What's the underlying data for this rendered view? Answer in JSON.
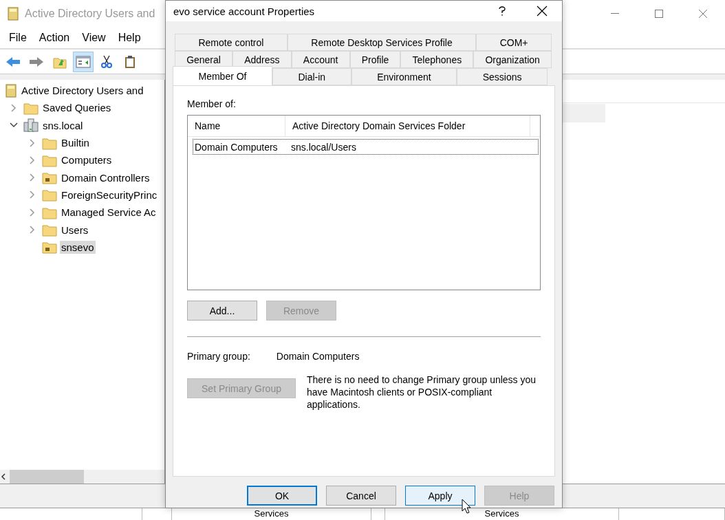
{
  "main_window": {
    "title": "Active Directory Users and",
    "menu": [
      "File",
      "Action",
      "View",
      "Help"
    ],
    "toolbar": [
      {
        "kind": "back",
        "selected": false
      },
      {
        "kind": "forward",
        "selected": false
      },
      {
        "kind": "up",
        "selected": false
      },
      {
        "kind": "tree",
        "selected": true
      },
      {
        "kind": "cut",
        "selected": false
      },
      {
        "kind": "paste",
        "selected": false
      }
    ],
    "tree": [
      {
        "label": "Active Directory Users and",
        "kind": "root",
        "selected": false,
        "children": [
          {
            "label": "Saved Queries",
            "kind": "folder",
            "expanded": false,
            "selected": false
          },
          {
            "label": "sns.local",
            "kind": "domain",
            "expanded": true,
            "selected": false,
            "children": [
              {
                "label": "Builtin",
                "kind": "folder",
                "expanded": false,
                "selected": false
              },
              {
                "label": "Computers",
                "kind": "folder",
                "expanded": false,
                "selected": false
              },
              {
                "label": "Domain Controllers",
                "kind": "ou",
                "expanded": false,
                "selected": false
              },
              {
                "label": "ForeignSecurityPrinc",
                "kind": "folder",
                "expanded": false,
                "selected": false
              },
              {
                "label": "Managed Service Ac",
                "kind": "folder",
                "expanded": false,
                "selected": false
              },
              {
                "label": "Users",
                "kind": "folder",
                "expanded": false,
                "selected": false
              },
              {
                "label": "snsevo",
                "kind": "ou",
                "selected": true
              }
            ]
          }
        ]
      }
    ],
    "bottom_strip": [
      "Services",
      "Services"
    ]
  },
  "dialog": {
    "title": "evo service account Properties",
    "tab_rows": [
      [
        {
          "label": "Remote control",
          "selected": false
        },
        {
          "label": "Remote Desktop Services Profile",
          "selected": false
        },
        {
          "label": "COM+",
          "selected": false
        }
      ],
      [
        {
          "label": "General",
          "selected": false
        },
        {
          "label": "Address",
          "selected": false
        },
        {
          "label": "Account",
          "selected": false
        },
        {
          "label": "Profile",
          "selected": false
        },
        {
          "label": "Telephones",
          "selected": false
        },
        {
          "label": "Organization",
          "selected": false
        }
      ],
      [
        {
          "label": "Member Of",
          "selected": true
        },
        {
          "label": "Dial-in",
          "selected": false
        },
        {
          "label": "Environment",
          "selected": false
        },
        {
          "label": "Sessions",
          "selected": false
        }
      ]
    ],
    "member_of_label": "Member of:",
    "table": {
      "columns": [
        "Name",
        "Active Directory Domain Services Folder"
      ],
      "rows": [
        {
          "cells": [
            "Domain Computers",
            "sns.local/Users"
          ],
          "selected": true
        }
      ]
    },
    "list_buttons": [
      {
        "label": "Add...",
        "disabled": false
      },
      {
        "label": "Remove",
        "disabled": true
      }
    ],
    "primary_group": {
      "label": "Primary group:",
      "value": "Domain Computers"
    },
    "set_primary_button": {
      "label": "Set Primary Group",
      "disabled": true
    },
    "note": "There is no need to change Primary group unless you have Macintosh clients or POSIX-compliant applications.",
    "footer_buttons": [
      {
        "label": "OK",
        "disabled": false,
        "kind": "default"
      },
      {
        "label": "Cancel",
        "disabled": false,
        "kind": "normal"
      },
      {
        "label": "Apply",
        "disabled": false,
        "kind": "hover"
      },
      {
        "label": "Help",
        "disabled": true,
        "kind": "normal"
      }
    ]
  }
}
